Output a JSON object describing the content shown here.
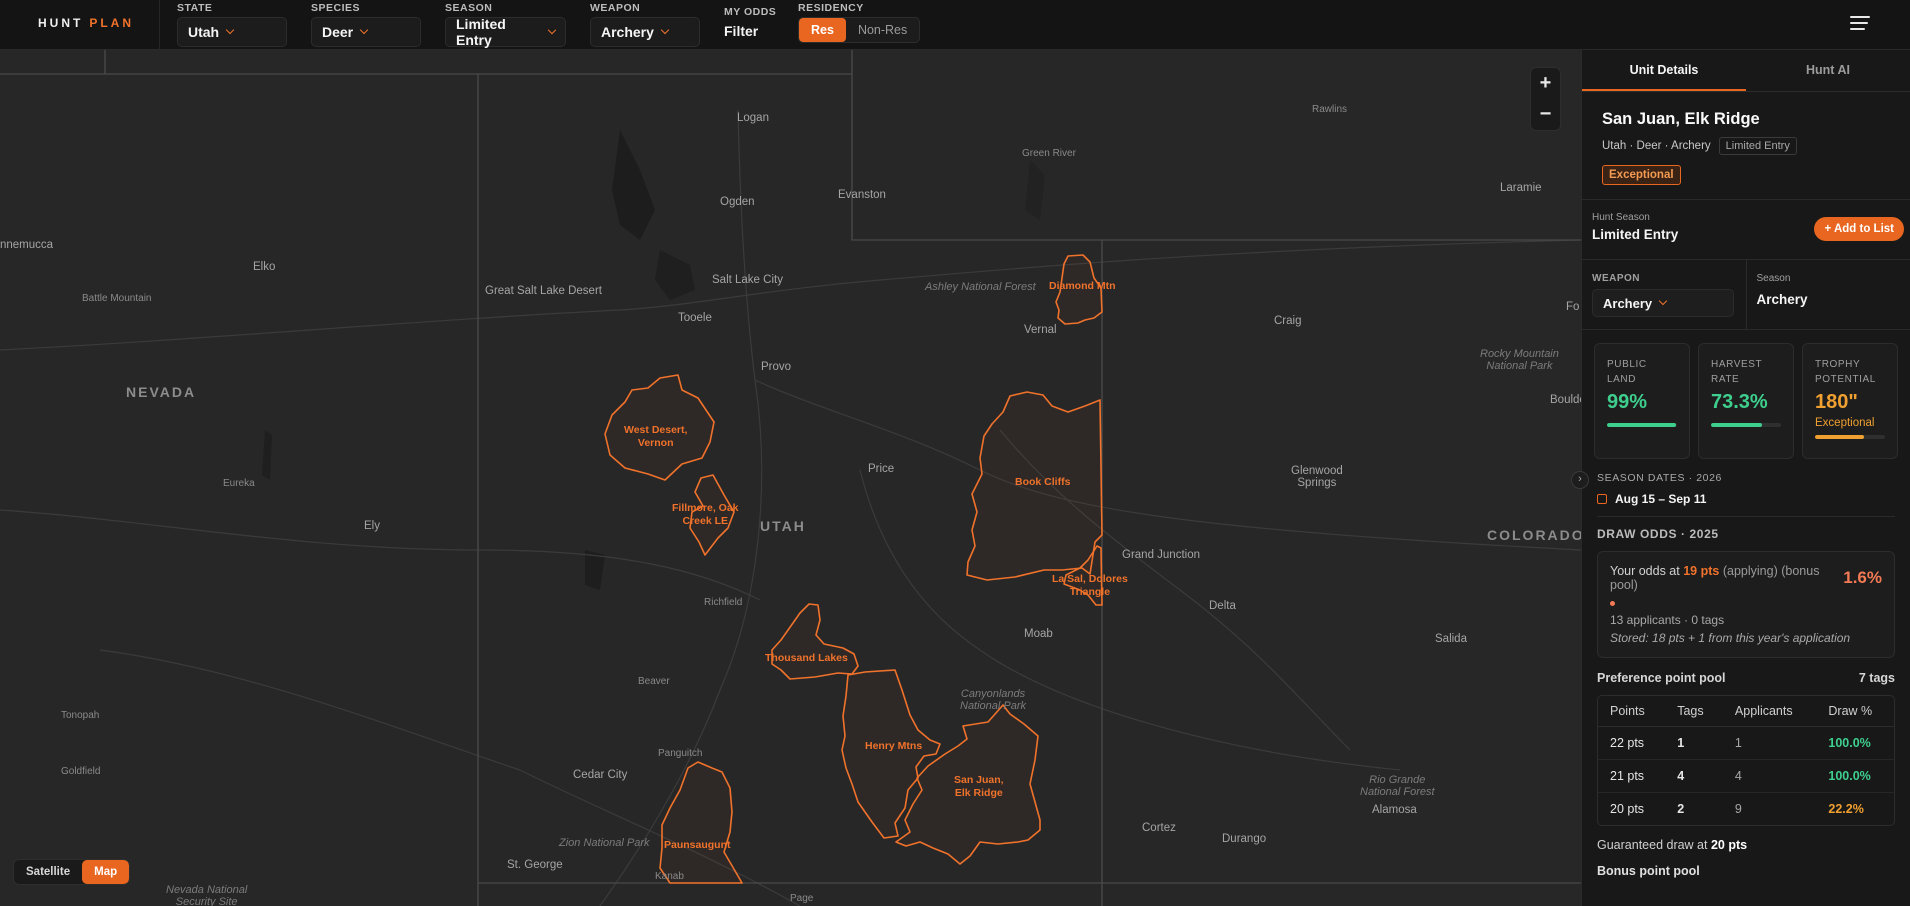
{
  "app": {
    "logo_left": "HUNT",
    "logo_right": "PLAN"
  },
  "filters": {
    "state": {
      "label": "STATE",
      "value": "Utah"
    },
    "species": {
      "label": "SPECIES",
      "value": "Deer"
    },
    "season": {
      "label": "SEASON",
      "value": "Limited Entry"
    },
    "weapon": {
      "label": "WEAPON",
      "value": "Archery"
    },
    "my_odds": {
      "label": "MY ODDS",
      "value": "Filter"
    },
    "residency": {
      "label": "RESIDENCY",
      "options": [
        "Res",
        "Non-Res"
      ],
      "selected": "Res"
    }
  },
  "map": {
    "zoom_in": "+",
    "zoom_out": "−",
    "collapse": "›",
    "basemap": {
      "options": [
        "Satellite",
        "Map"
      ],
      "selected": "Map"
    },
    "places": [
      "Logan",
      "Rawlins",
      "Green River",
      "Ogden",
      "Evanston",
      "Laramie",
      "Salt Lake City",
      "Great Salt Lake Desert",
      "Tooele",
      "Vernal",
      "Craig",
      "Provo",
      "Price",
      "Glenwood Springs",
      "Boulder",
      "Grand Junction",
      "Delta",
      "Moab",
      "Salida",
      "Richfield",
      "Beaver",
      "Cedar City",
      "Panguitch",
      "St. George",
      "Kanab",
      "Page",
      "Cortez",
      "Durango",
      "Alamosa",
      "Elko",
      "Ely",
      "Eureka",
      "Tonopah",
      "Goldfield",
      "Winnemucca",
      "Battle Mountain",
      "Fo"
    ],
    "parks": [
      "Ashley National Forest",
      "Rocky Mountain\nNational Park",
      "Canyonlands\nNational Park",
      "Rio Grande\nNational Forest",
      "Zion National Park",
      "Nevada National\nSecurity Site"
    ],
    "states": [
      "NEVADA",
      "UTAH",
      "COLORADO"
    ],
    "units": [
      "Diamond Mtn",
      "West Desert,\nVernon",
      "Fillmore, Oak\nCreek LE",
      "Book Cliffs",
      "La Sal, Dolores\nTriangle",
      "Thousand Lakes",
      "Henry Mtns",
      "San Juan,\nElk Ridge",
      "Paunsaugunt"
    ]
  },
  "panel": {
    "tabs": [
      "Unit Details",
      "Hunt AI"
    ],
    "unit_title": "San Juan, Elk Ridge",
    "unit_meta": "Utah · Deer · Archery",
    "unit_chip": "Limited Entry",
    "unit_badge": "Exceptional",
    "hunt_season_label": "Hunt Season",
    "hunt_season_value": "Limited Entry",
    "add_button": "Add to List",
    "weapon_label": "WEAPON",
    "weapon_value": "Archery",
    "season_label": "Season",
    "season_value": "Archery",
    "stats": [
      {
        "label": "PUBLIC LAND",
        "value": "99%",
        "sub": "",
        "color": "#3ecf8e",
        "level": 0.99
      },
      {
        "label": "HARVEST RATE",
        "value": "73.3%",
        "sub": "",
        "color": "#3ecf8e",
        "level": 0.733
      },
      {
        "label": "TROPHY POTENTIAL",
        "value": "180\"",
        "sub": "Exceptional",
        "color": "#f0a030",
        "level": 0.7
      }
    ],
    "season_dates_label": "SEASON DATES · 2026",
    "season_dates": "Aug 15 – Sep 11",
    "draw_odds_title": "DRAW ODDS · 2025",
    "odds": {
      "prefix": "Your odds at",
      "points": "19 pts",
      "applying": "(applying)",
      "pool": "(bonus pool)",
      "percent": "1.6%",
      "meta": "13 applicants · 0 tags",
      "stored": "Stored: 18 pts + 1 from this year's application"
    },
    "pref_pool_label": "Preference point pool",
    "pref_pool_tags": "7 tags",
    "table": {
      "headers": [
        "Points",
        "Tags",
        "Applicants",
        "Draw %"
      ],
      "rows": [
        {
          "points": "22 pts",
          "tags": "1",
          "applicants": "1",
          "draw": "100.0%",
          "draw_color": "#3ecf8e"
        },
        {
          "points": "21 pts",
          "tags": "4",
          "applicants": "4",
          "draw": "100.0%",
          "draw_color": "#3ecf8e"
        },
        {
          "points": "20 pts",
          "tags": "2",
          "applicants": "9",
          "draw": "22.2%",
          "draw_color": "#f0a030"
        }
      ]
    },
    "guaranteed_prefix": "Guaranteed draw at",
    "guaranteed_value": "20 pts",
    "bonus_pool_label": "Bonus point pool"
  }
}
